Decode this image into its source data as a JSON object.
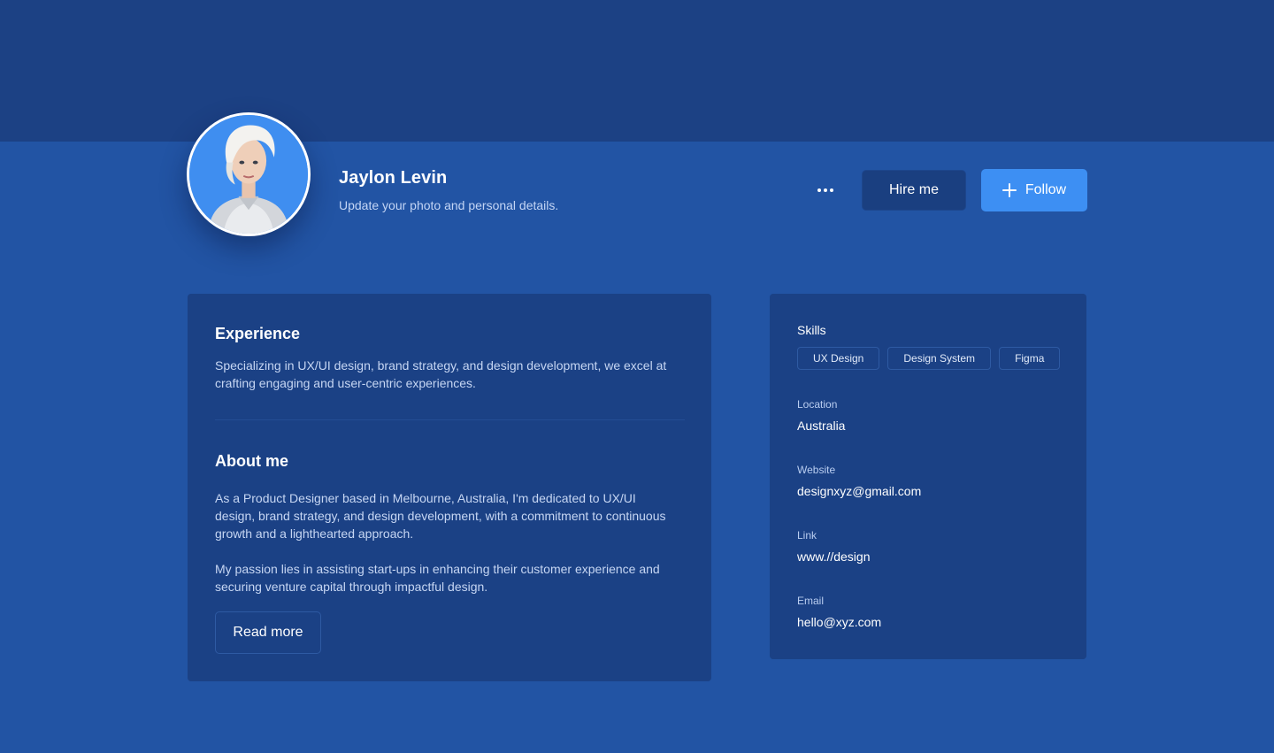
{
  "profile": {
    "name": "Jaylon Levin",
    "subtitle": "Update your photo and personal details."
  },
  "actions": {
    "more_icon": "more-horizontal-icon",
    "hire_label": "Hire me",
    "follow_label": "Follow",
    "follow_icon": "plus-icon"
  },
  "colors": {
    "banner": "#1c4184",
    "background": "#2254a4",
    "card": "#1b4185",
    "accent": "#3d8ff3"
  },
  "experience": {
    "title": "Experience",
    "text": "Specializing in UX/UI design, brand strategy, and design development, we excel at crafting engaging and user-centric experiences."
  },
  "about": {
    "title": "About me",
    "paragraph1": "As a Product Designer based in Melbourne, Australia, I'm dedicated to UX/UI design, brand strategy, and design development, with a commitment to continuous growth and a lighthearted approach.",
    "paragraph2": "My passion lies in assisting start-ups in enhancing their customer experience and securing venture capital through impactful design.",
    "read_more_label": "Read more"
  },
  "details": {
    "skills_title": "Skills",
    "skills": [
      "UX Design",
      "Design System",
      "Figma"
    ],
    "location_label": "Location",
    "location_value": "Australia",
    "website_label": "Website",
    "website_value": "designxyz@gmail.com",
    "link_label": "Link",
    "link_value": "www.//design",
    "email_label": "Email",
    "email_value": "hello@xyz.com"
  }
}
